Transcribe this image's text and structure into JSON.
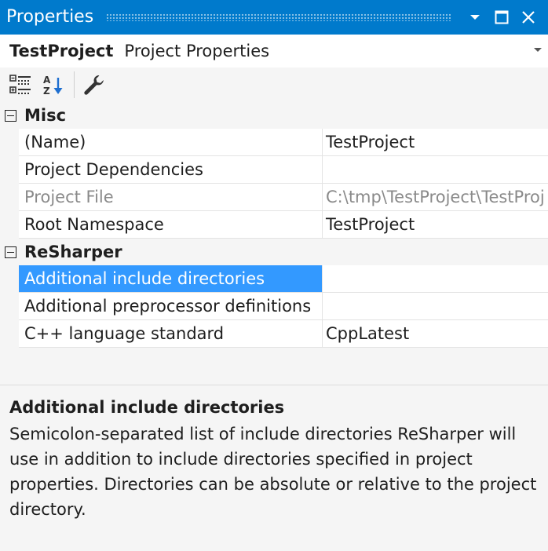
{
  "window": {
    "title": "Properties",
    "title_bar_color": "#007acc"
  },
  "selector": {
    "object_name": "TestProject",
    "object_type": "Project Properties"
  },
  "toolbar": {
    "items": [
      {
        "name": "categorized-icon"
      },
      {
        "name": "alphabetical-icon"
      },
      {
        "name": "property-pages-wrench-icon"
      }
    ]
  },
  "categories": [
    {
      "label": "Misc",
      "rows": [
        {
          "name": "(Name)",
          "value": "TestProject",
          "dim": false,
          "selected": false
        },
        {
          "name": "Project Dependencies",
          "value": "",
          "dim": false,
          "selected": false
        },
        {
          "name": "Project File",
          "value": "C:\\tmp\\TestProject\\TestProj",
          "dim": true,
          "selected": false
        },
        {
          "name": "Root Namespace",
          "value": "TestProject",
          "dim": false,
          "selected": false
        }
      ]
    },
    {
      "label": "ReSharper",
      "rows": [
        {
          "name": "Additional include directories",
          "value": "",
          "dim": false,
          "selected": true
        },
        {
          "name": "Additional preprocessor definitions",
          "value": "",
          "dim": false,
          "selected": false
        },
        {
          "name": "C++ language standard",
          "value": "CppLatest",
          "dim": false,
          "selected": false
        }
      ]
    }
  ],
  "description": {
    "title": "Additional include directories",
    "body": "Semicolon-separated list of include directories ReSharper will use in addition to include directories specified in project properties. Directories can be absolute or relative to the project directory."
  },
  "colors": {
    "accent": "#007acc",
    "selection": "#3399ff"
  }
}
